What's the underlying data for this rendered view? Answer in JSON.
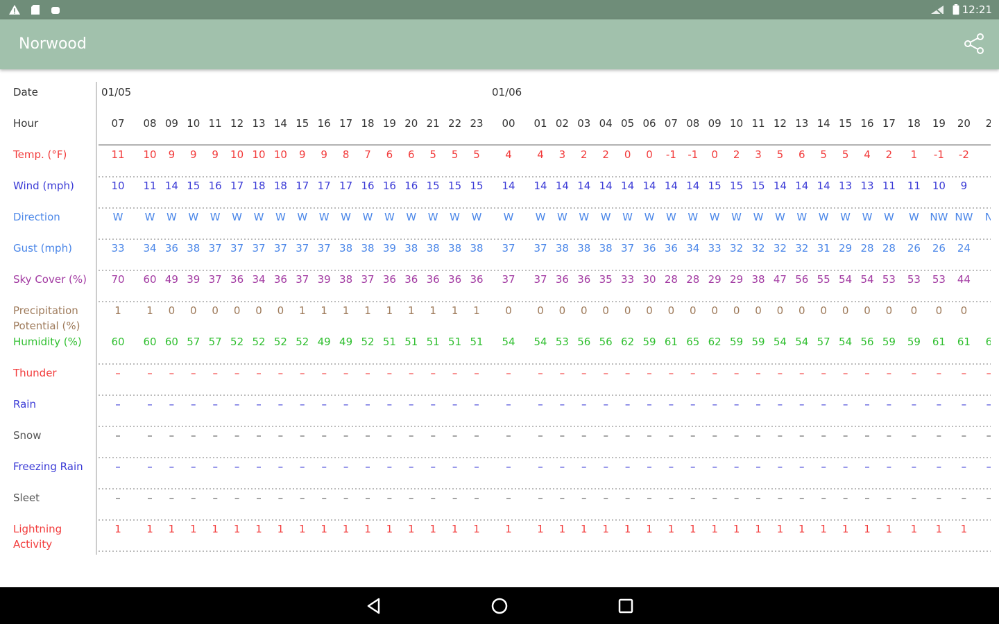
{
  "status_bar": {
    "time": "12:21",
    "left_icons": [
      "warning-icon",
      "sd-card-icon",
      "android-icon"
    ],
    "right_icons": [
      "wifi-off-icon",
      "battery-icon"
    ]
  },
  "app_bar": {
    "title": "Norwood",
    "share_icon": "share-icon",
    "color": "#a1c1ac"
  },
  "nav_bar": {
    "icons": [
      "back-icon",
      "home-icon",
      "recents-icon"
    ]
  },
  "table": {
    "dates": [
      {
        "label": "01/05",
        "col": 0
      },
      {
        "label": "01/06",
        "col": 17
      }
    ],
    "hours": [
      "07",
      "08",
      "09",
      "10",
      "11",
      "12",
      "13",
      "14",
      "15",
      "16",
      "17",
      "18",
      "19",
      "20",
      "21",
      "22",
      "23",
      "00",
      "01",
      "02",
      "03",
      "04",
      "05",
      "06",
      "07",
      "08",
      "09",
      "10",
      "11",
      "12",
      "13",
      "14",
      "15",
      "16",
      "17",
      "18",
      "19",
      "20",
      "2"
    ],
    "rows": [
      {
        "key": "temp",
        "label": [
          "Temp. (°F)"
        ],
        "color": "#f23b3b",
        "values": [
          "11",
          "10",
          "9",
          "9",
          "9",
          "10",
          "10",
          "10",
          "9",
          "9",
          "8",
          "7",
          "6",
          "6",
          "5",
          "5",
          "5",
          "4",
          "4",
          "3",
          "2",
          "2",
          "0",
          "0",
          "-1",
          "-1",
          "0",
          "2",
          "3",
          "5",
          "6",
          "5",
          "5",
          "4",
          "2",
          "1",
          "-1",
          "-2",
          ""
        ]
      },
      {
        "key": "wind",
        "label": [
          "Wind (mph)"
        ],
        "color": "#3a3ad6",
        "values": [
          "10",
          "11",
          "14",
          "15",
          "16",
          "17",
          "18",
          "18",
          "17",
          "17",
          "17",
          "16",
          "16",
          "16",
          "15",
          "15",
          "15",
          "14",
          "14",
          "14",
          "14",
          "14",
          "14",
          "14",
          "14",
          "14",
          "15",
          "15",
          "15",
          "14",
          "14",
          "14",
          "13",
          "13",
          "11",
          "11",
          "10",
          "9",
          ""
        ]
      },
      {
        "key": "direction",
        "label": [
          "Direction"
        ],
        "color": "#4a86e8",
        "values": [
          "W",
          "W",
          "W",
          "W",
          "W",
          "W",
          "W",
          "W",
          "W",
          "W",
          "W",
          "W",
          "W",
          "W",
          "W",
          "W",
          "W",
          "W",
          "W",
          "W",
          "W",
          "W",
          "W",
          "W",
          "W",
          "W",
          "W",
          "W",
          "W",
          "W",
          "W",
          "W",
          "W",
          "W",
          "W",
          "W",
          "NW",
          "NW",
          "N"
        ]
      },
      {
        "key": "gust",
        "label": [
          "Gust (mph)"
        ],
        "color": "#4a86e8",
        "values": [
          "33",
          "34",
          "36",
          "38",
          "37",
          "37",
          "37",
          "37",
          "37",
          "37",
          "38",
          "38",
          "39",
          "38",
          "38",
          "38",
          "38",
          "37",
          "37",
          "38",
          "38",
          "38",
          "37",
          "36",
          "36",
          "34",
          "33",
          "32",
          "32",
          "32",
          "32",
          "31",
          "29",
          "28",
          "28",
          "26",
          "26",
          "24",
          ""
        ]
      },
      {
        "key": "sky",
        "label": [
          "Sky Cover (%)"
        ],
        "color": "#a23aa2",
        "values": [
          "70",
          "60",
          "49",
          "39",
          "37",
          "36",
          "34",
          "36",
          "37",
          "39",
          "38",
          "37",
          "36",
          "36",
          "36",
          "36",
          "36",
          "37",
          "37",
          "36",
          "36",
          "35",
          "33",
          "30",
          "28",
          "28",
          "29",
          "29",
          "38",
          "47",
          "56",
          "55",
          "54",
          "54",
          "53",
          "53",
          "53",
          "44",
          ""
        ]
      },
      {
        "key": "precip",
        "label": [
          "Precipitation",
          "Potential (%)"
        ],
        "color": "#9e7a5a",
        "values": [
          "1",
          "1",
          "0",
          "0",
          "0",
          "0",
          "0",
          "0",
          "1",
          "1",
          "1",
          "1",
          "1",
          "1",
          "1",
          "1",
          "1",
          "0",
          "0",
          "0",
          "0",
          "0",
          "0",
          "0",
          "0",
          "0",
          "0",
          "0",
          "0",
          "0",
          "0",
          "0",
          "0",
          "0",
          "0",
          "0",
          "0",
          "0",
          ""
        ]
      },
      {
        "key": "humidity",
        "label": [
          "Humidity (%)"
        ],
        "color": "#2fbf2f",
        "values": [
          "60",
          "60",
          "60",
          "57",
          "57",
          "52",
          "52",
          "52",
          "52",
          "49",
          "49",
          "52",
          "51",
          "51",
          "51",
          "51",
          "51",
          "54",
          "54",
          "53",
          "56",
          "56",
          "62",
          "59",
          "61",
          "65",
          "62",
          "59",
          "59",
          "54",
          "54",
          "57",
          "54",
          "56",
          "59",
          "59",
          "61",
          "61",
          "6"
        ]
      },
      {
        "key": "thunder",
        "label": [
          "Thunder"
        ],
        "color": "#f23b3b",
        "dash": true,
        "values": []
      },
      {
        "key": "rain",
        "label": [
          "Rain"
        ],
        "color": "#3a3ad6",
        "dash": true,
        "values": []
      },
      {
        "key": "snow",
        "label": [
          "Snow"
        ],
        "color": "#555555",
        "dash": true,
        "values": []
      },
      {
        "key": "freezing_rain",
        "label": [
          "Freezing Rain"
        ],
        "color": "#3a3ad6",
        "dash": true,
        "values": []
      },
      {
        "key": "sleet",
        "label": [
          "Sleet"
        ],
        "color": "#555555",
        "dash": true,
        "values": []
      },
      {
        "key": "lightning",
        "label": [
          "Lightning",
          "Activity"
        ],
        "color": "#f23b3b",
        "values": [
          "1",
          "1",
          "1",
          "1",
          "1",
          "1",
          "1",
          "1",
          "1",
          "1",
          "1",
          "1",
          "1",
          "1",
          "1",
          "1",
          "1",
          "1",
          "1",
          "1",
          "1",
          "1",
          "1",
          "1",
          "1",
          "1",
          "1",
          "1",
          "1",
          "1",
          "1",
          "1",
          "1",
          "1",
          "1",
          "1",
          "1",
          "1",
          ""
        ]
      }
    ],
    "header_labels": {
      "date": "Date",
      "hour": "Hour"
    },
    "dash_char": "–"
  }
}
